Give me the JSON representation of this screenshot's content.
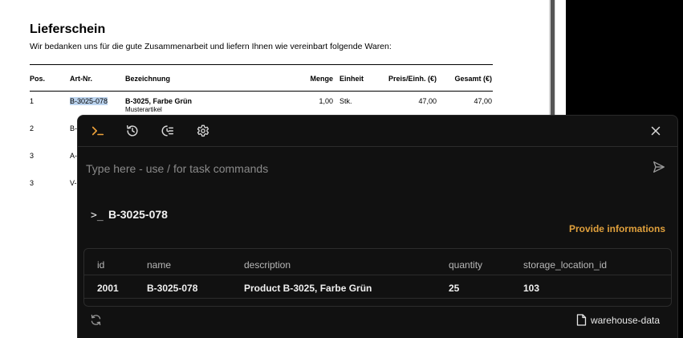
{
  "document": {
    "title": "Lieferschein",
    "subtitle": "Wir bedanken uns für die gute Zusammenarbeit und liefern Ihnen wie vereinbart folgende Waren:",
    "columns": {
      "pos": "Pos.",
      "art": "Art-Nr.",
      "bez": "Bezeichnung",
      "menge": "Menge",
      "einheit": "Einheit",
      "preis": "Preis/Einh. (€)",
      "gesamt": "Gesamt (€)"
    },
    "rows": [
      {
        "pos": "1",
        "art": "B-3025-078",
        "bez": "B-3025, Farbe Grün",
        "bez_sub": "Musterartikel",
        "menge": "1,00",
        "einheit": "Stk.",
        "preis": "47,00",
        "gesamt": "47,00"
      },
      {
        "pos": "2",
        "art": "B-"
      },
      {
        "pos": "3",
        "art": "A-"
      },
      {
        "pos": "3",
        "art": "V-"
      }
    ]
  },
  "panel": {
    "input_placeholder": "Type here - use / for task commands",
    "prompt_symbol": ">_",
    "result_title": "B-3025-078",
    "provide_info": "Provide informations",
    "table": {
      "headers": [
        "id",
        "name",
        "description",
        "quantity",
        "storage_location_id"
      ],
      "rows": [
        [
          "2001",
          "B-3025-078",
          "Product B-3025, Farbe Grün",
          "25",
          "103"
        ]
      ]
    },
    "source": "warehouse-data"
  },
  "colors": {
    "accent": "#f0a33a",
    "panel_bg": "#111111",
    "highlight": "#bcd4ef"
  },
  "icons": [
    "terminal-icon",
    "history-icon",
    "clear-history-icon",
    "gear-icon",
    "close-icon",
    "send-icon",
    "refresh-icon",
    "file-icon"
  ]
}
